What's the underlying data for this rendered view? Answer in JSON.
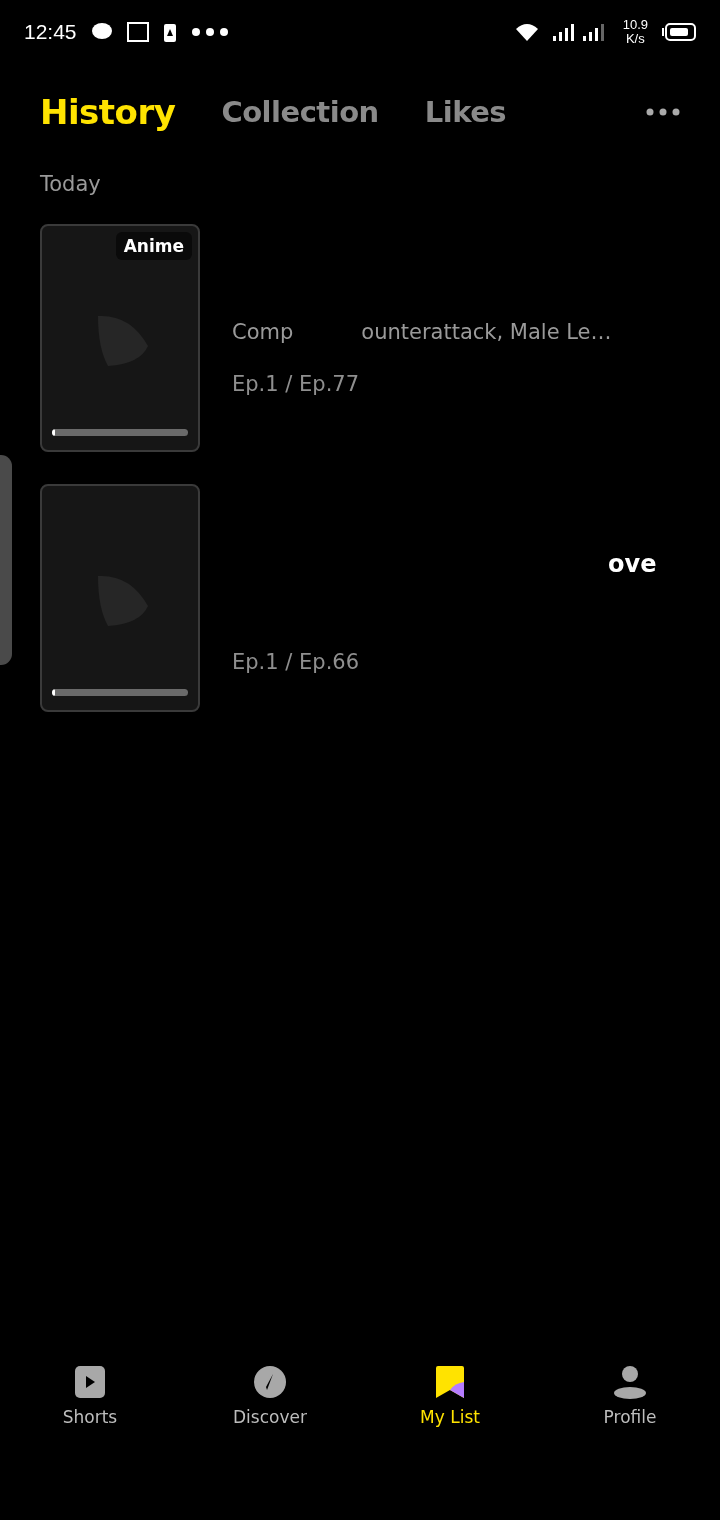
{
  "status_bar": {
    "time": "12:45",
    "speed_value": "10.9",
    "speed_unit": "K/s"
  },
  "tabs": [
    {
      "label": "History",
      "selected": true
    },
    {
      "label": "Collection",
      "selected": false
    },
    {
      "label": "Likes",
      "selected": false
    }
  ],
  "section": "Today",
  "items": [
    {
      "badge": "Anime",
      "subtitle_parts": [
        "Comp",
        "ounterattack, Male Le…"
      ],
      "episodes": "Ep.1 / Ep.77",
      "level": 0.02
    },
    {
      "title_part": "ove",
      "episodes": "Ep.1 / Ep.66",
      "level": 0.02
    }
  ],
  "nav": [
    {
      "kind": "shorts",
      "label": "Shorts",
      "selected": false
    },
    {
      "kind": "discover",
      "label": "Discover",
      "selected": false
    },
    {
      "kind": "mylist",
      "label": "My List",
      "selected": true
    },
    {
      "kind": "profile",
      "label": "Profile",
      "selected": false
    }
  ]
}
